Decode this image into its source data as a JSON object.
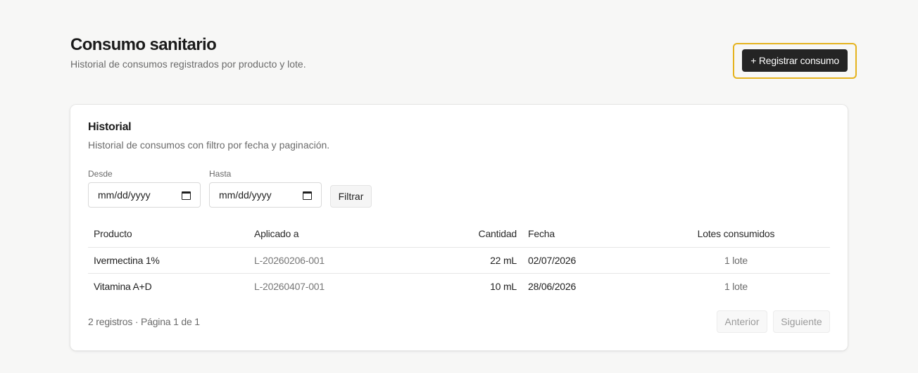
{
  "header": {
    "title": "Consumo sanitario",
    "subtitle": "Historial de consumos registrados por producto y lote.",
    "register_button": "+ Registrar consumo"
  },
  "card": {
    "title": "Historial",
    "description": "Historial de consumos con filtro por fecha y paginación.",
    "filters": {
      "from_label": "Desde",
      "from_placeholder": "mm/dd/yyyy",
      "to_label": "Hasta",
      "to_placeholder": "mm/dd/yyyy",
      "filter_button": "Filtrar"
    },
    "table": {
      "columns": [
        "Producto",
        "Aplicado a",
        "Cantidad",
        "Fecha",
        "Lotes consumidos"
      ],
      "rows": [
        {
          "producto": "Ivermectina 1%",
          "aplicado": "L-20260206-001",
          "cantidad": "22 mL",
          "fecha": "02/07/2026",
          "lotes": "1 lote"
        },
        {
          "producto": "Vitamina A+D",
          "aplicado": "L-20260407-001",
          "cantidad": "10 mL",
          "fecha": "28/06/2026",
          "lotes": "1 lote"
        }
      ]
    },
    "footer": {
      "info": "2 registros · Página 1 de 1",
      "prev_button": "Anterior",
      "next_button": "Siguiente"
    }
  },
  "colors": {
    "background": "#f7f7f6",
    "primary_button": "#242424",
    "focus_ring": "#e5b31e"
  }
}
